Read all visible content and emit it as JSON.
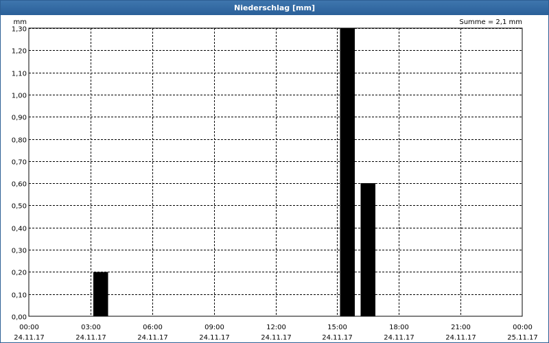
{
  "window": {
    "title": "Niederschlag [mm]"
  },
  "summary": "Summe = 2,1 mm",
  "colors": {
    "title_bar": "#2d66a0",
    "bars": "#000000",
    "grid": "#000000",
    "background": "#ffffff"
  },
  "chart_data": {
    "type": "bar",
    "title": "Niederschlag [mm]",
    "ylabel": "mm",
    "xlabel": "",
    "ylim": [
      0,
      1.3
    ],
    "yticks": [
      "0,00",
      "0,10",
      "0,20",
      "0,30",
      "0,40",
      "0,50",
      "0,60",
      "0,70",
      "0,80",
      "0,90",
      "1,00",
      "1,10",
      "1,20",
      "1,30"
    ],
    "x_range_hours": [
      0,
      24
    ],
    "xticks": [
      {
        "time": "00:00",
        "date": "24.11.17"
      },
      {
        "time": "03:00",
        "date": "24.11.17"
      },
      {
        "time": "06:00",
        "date": "24.11.17"
      },
      {
        "time": "09:00",
        "date": "24.11.17"
      },
      {
        "time": "12:00",
        "date": "24.11.17"
      },
      {
        "time": "15:00",
        "date": "24.11.17"
      },
      {
        "time": "18:00",
        "date": "24.11.17"
      },
      {
        "time": "21:00",
        "date": "24.11.17"
      },
      {
        "time": "00:00",
        "date": "25.11.17"
      }
    ],
    "bar_interval_hours": 1,
    "bars": [
      {
        "start": "24.11.17 03:00",
        "end": "24.11.17 04:00",
        "value": 0.2
      },
      {
        "start": "24.11.17 15:00",
        "end": "24.11.17 16:00",
        "value": 1.3
      },
      {
        "start": "24.11.17 16:00",
        "end": "24.11.17 17:00",
        "value": 0.6
      }
    ],
    "grid": true,
    "legend": "none"
  }
}
